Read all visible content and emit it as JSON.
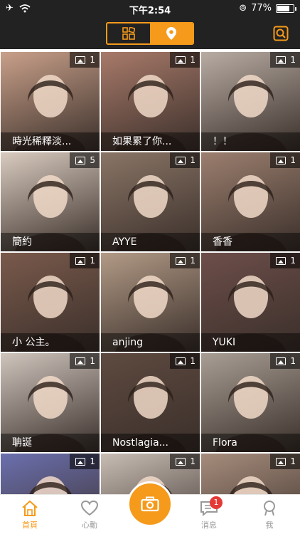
{
  "status_bar": {
    "time": "下午2:54",
    "battery": "77%",
    "battery_level": 0.77
  },
  "nav": {
    "view_modes": [
      "grid-icon",
      "location-pin-icon"
    ],
    "active_mode": 1
  },
  "accent_color": "#f59a1b",
  "profiles": [
    {
      "name": "時光稀釋淡...",
      "photos": "1",
      "color": "#c9a08a"
    },
    {
      "name": "如果累了你...",
      "photos": "1",
      "color": "#a87a6a"
    },
    {
      "name": "！！",
      "photos": "1",
      "color": "#b8aca3"
    },
    {
      "name": "簡約",
      "photos": "5",
      "color": "#d9cbbf"
    },
    {
      "name": "AYYE",
      "photos": "1",
      "color": "#8a7566"
    },
    {
      "name": "香香",
      "photos": "1",
      "color": "#9c7f6f"
    },
    {
      "name": "小 公主。",
      "photos": "1",
      "color": "#7a5a4c"
    },
    {
      "name": "anjing",
      "photos": "1",
      "color": "#b29a86"
    },
    {
      "name": "YUKI",
      "photos": "1",
      "color": "#6d4e4a"
    },
    {
      "name": "聃誕",
      "photos": "1",
      "color": "#cfc5bd"
    },
    {
      "name": "Nostlagia...",
      "photos": "1",
      "color": "#5e4a40"
    },
    {
      "name": "Flora",
      "photos": "1",
      "color": "#a89e94"
    },
    {
      "name": "",
      "photos": "1",
      "color": "#6b6fae"
    },
    {
      "name": "",
      "photos": "1",
      "color": "#c8bdb4"
    },
    {
      "name": "",
      "photos": "1",
      "color": "#a68c7c"
    }
  ],
  "tabs": [
    {
      "label": "首頁",
      "icon": "home-icon",
      "active": true
    },
    {
      "label": "心動",
      "icon": "heart-icon",
      "active": false
    },
    {
      "label": "消息",
      "icon": "message-icon",
      "active": false,
      "badge": "1"
    },
    {
      "label": "我",
      "icon": "profile-icon",
      "active": false
    }
  ]
}
